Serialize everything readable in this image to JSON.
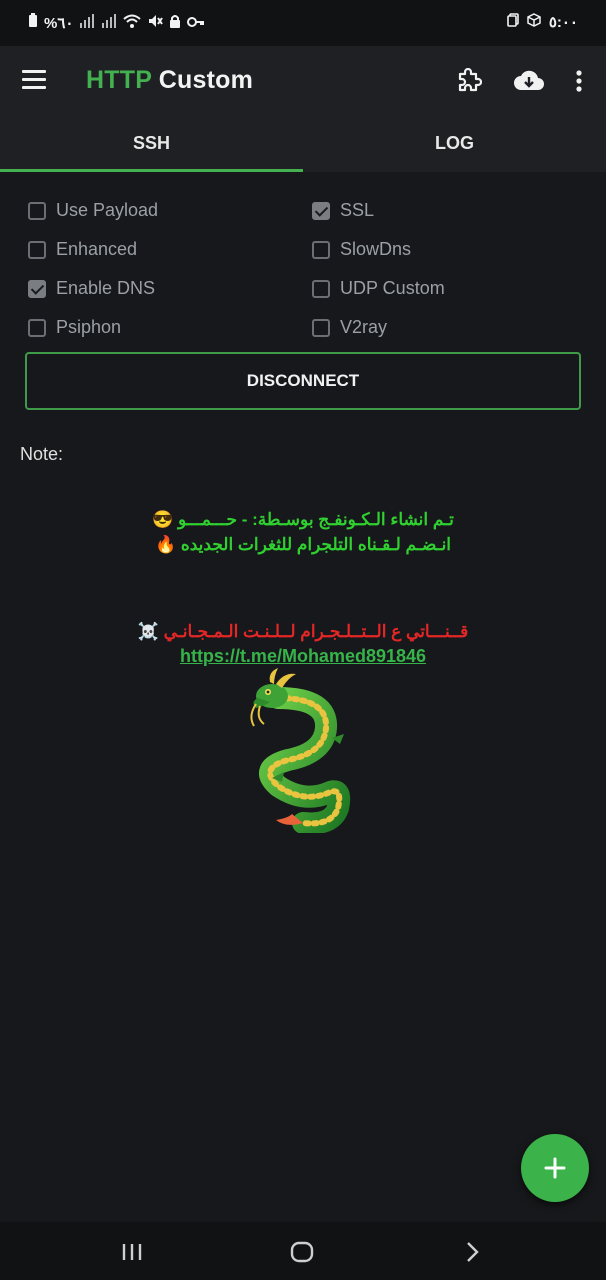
{
  "status_bar": {
    "left_text": "%٦٠",
    "right_time": "٥:٠٠"
  },
  "app_bar": {
    "title_part1": "HTTP",
    "title_part2": " Custom",
    "actions": [
      "puzzle-icon",
      "cloud-download-icon",
      "more-vert-icon"
    ]
  },
  "tabs": [
    {
      "label": "SSH",
      "active": true
    },
    {
      "label": "LOG",
      "active": false
    }
  ],
  "options": [
    {
      "label": "Use Payload",
      "checked": false
    },
    {
      "label": "SSL",
      "checked": true
    },
    {
      "label": "Enhanced",
      "checked": false
    },
    {
      "label": "SlowDns",
      "checked": false
    },
    {
      "label": "Enable DNS",
      "checked": true
    },
    {
      "label": "UDP Custom",
      "checked": false
    },
    {
      "label": "Psiphon",
      "checked": false
    },
    {
      "label": "V2ray",
      "checked": false
    }
  ],
  "disconnect_label": "DISCONNECT",
  "note": {
    "label": "Note:",
    "line1": "تـم انشاء الـكـونفـج بوسـطة: - حـــمـــو 😎",
    "line2": "انـضـم لـقـناه التلجرام للثغرات الجديده 🔥",
    "line3": "قــنـــاتي ع الــتــلـجـرام لــلـنـت الـمـجـانـي ☠️",
    "link": "https://t.me/Mohamed891846"
  },
  "colors": {
    "accent": "#43b14f",
    "background": "#17181b",
    "appbar": "#1f2023",
    "note_green": "#2fd02f",
    "note_red": "#e32626"
  }
}
